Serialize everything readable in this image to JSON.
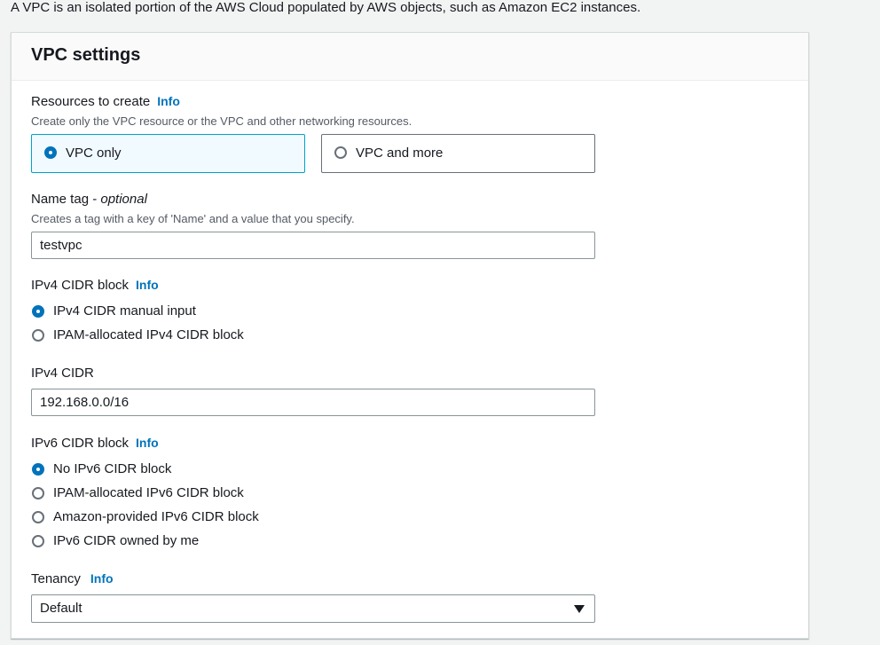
{
  "intro_text": "A VPC is an isolated portion of the AWS Cloud populated by AWS objects, such as Amazon EC2 instances.",
  "panel": {
    "title": "VPC settings"
  },
  "resources": {
    "label": "Resources to create",
    "info": "Info",
    "description": "Create only the VPC resource or the VPC and other networking resources.",
    "options": [
      {
        "label": "VPC only",
        "selected": true
      },
      {
        "label": "VPC and more",
        "selected": false
      }
    ]
  },
  "name_tag": {
    "label": "Name tag - ",
    "label_optional": "optional",
    "description": "Creates a tag with a key of 'Name' and a value that you specify.",
    "value": "testvpc"
  },
  "ipv4_block": {
    "label": "IPv4 CIDR block",
    "info": "Info",
    "options": [
      {
        "label": "IPv4 CIDR manual input",
        "selected": true
      },
      {
        "label": "IPAM-allocated IPv4 CIDR block",
        "selected": false
      }
    ]
  },
  "ipv4_cidr": {
    "label": "IPv4 CIDR",
    "value": "192.168.0.0/16"
  },
  "ipv6_block": {
    "label": "IPv6 CIDR block",
    "info": "Info",
    "options": [
      {
        "label": "No IPv6 CIDR block",
        "selected": true
      },
      {
        "label": "IPAM-allocated IPv6 CIDR block",
        "selected": false
      },
      {
        "label": "Amazon-provided IPv6 CIDR block",
        "selected": false
      },
      {
        "label": "IPv6 CIDR owned by me",
        "selected": false
      }
    ]
  },
  "tenancy": {
    "label": "Tenancy",
    "info": "Info",
    "value": "Default"
  },
  "colors": {
    "accent": "#0073bb",
    "selected_tile_bg": "#f1faff",
    "selected_tile_border": "#00a1c9"
  }
}
